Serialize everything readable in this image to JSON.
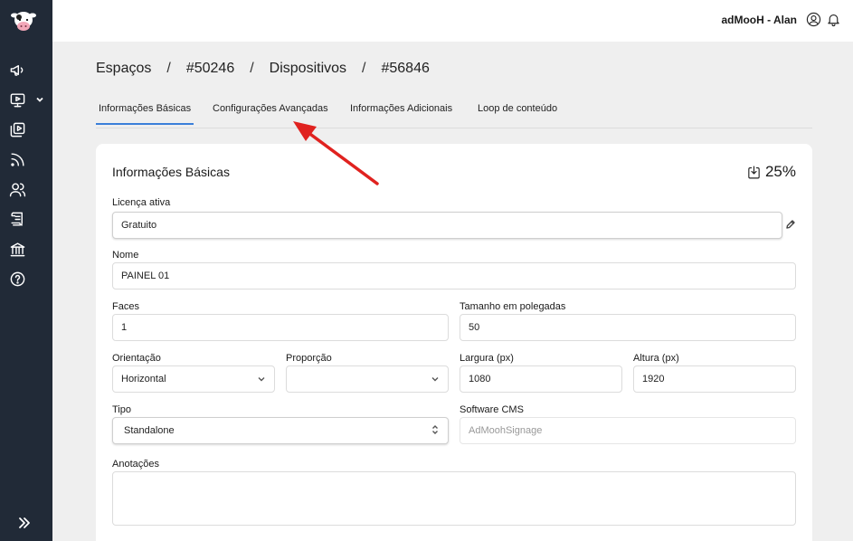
{
  "topbar": {
    "user_label": "adMooH - Alan",
    "user_icon": "user-circle-icon",
    "bell_icon": "bell-icon"
  },
  "sidebar": {
    "logo_icon": "cow-logo-icon",
    "items": [
      {
        "name": "megaphone-icon"
      },
      {
        "name": "monitor-play-icon"
      },
      {
        "name": "media-library-icon"
      },
      {
        "name": "rss-icon"
      },
      {
        "name": "users-icon"
      },
      {
        "name": "scroll-icon"
      },
      {
        "name": "bank-icon"
      },
      {
        "name": "help-icon"
      }
    ],
    "expand_icon": "double-chevron-right-icon"
  },
  "breadcrumb": [
    "Espaços",
    "#50246",
    "Dispositivos",
    "#56846"
  ],
  "breadcrumb_sep": "/",
  "tabs": [
    {
      "label": "Informações Básicas",
      "active": true
    },
    {
      "label": "Configurações Avançadas",
      "active": false
    },
    {
      "label": "Informações Adicionais",
      "active": false
    },
    {
      "label": "Loop de conteúdo",
      "active": false
    }
  ],
  "card": {
    "title": "Informações Básicas",
    "completion": "25%",
    "fields": {
      "license": {
        "label": "Licença ativa",
        "value": "Gratuito"
      },
      "name": {
        "label": "Nome",
        "value": "PAINEL 01"
      },
      "faces": {
        "label": "Faces",
        "value": "1"
      },
      "size": {
        "label": "Tamanho em polegadas",
        "value": "50"
      },
      "orientation": {
        "label": "Orientação",
        "value": "Horizontal"
      },
      "proportion": {
        "label": "Proporção",
        "value": ""
      },
      "width": {
        "label": "Largura (px)",
        "value": "1080"
      },
      "height": {
        "label": "Altura (px)",
        "value": "1920"
      },
      "type": {
        "label": "Tipo",
        "value": "Standalone"
      },
      "cms": {
        "label": "Software CMS",
        "value": "AdMoohSignage"
      },
      "notes": {
        "label": "Anotações",
        "value": ""
      }
    }
  },
  "colors": {
    "sidebar_bg": "#212a37",
    "active_tab": "#3b7fd9",
    "annotation_arrow": "#e0221f"
  }
}
